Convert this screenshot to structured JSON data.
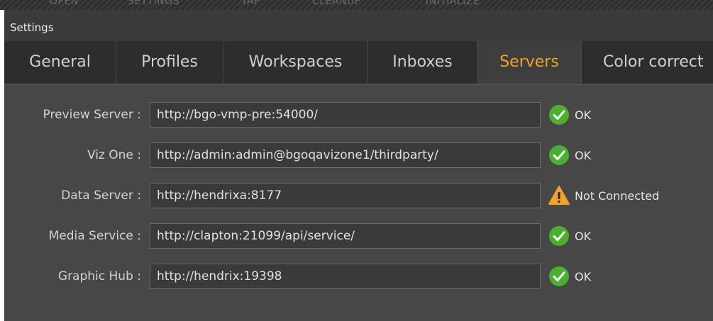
{
  "background_toolbar": {
    "labels": [
      "OPEN",
      "SETTINGS",
      "TAP",
      "CLEANUP",
      "INITIALIZE"
    ]
  },
  "dialog": {
    "title": "Settings"
  },
  "tabs": [
    {
      "label": "General",
      "active": false
    },
    {
      "label": "Profiles",
      "active": false
    },
    {
      "label": "Workspaces",
      "active": false
    },
    {
      "label": "Inboxes",
      "active": false
    },
    {
      "label": "Servers",
      "active": true
    },
    {
      "label": "Color correct",
      "active": false
    }
  ],
  "servers": [
    {
      "label": "Preview Server :",
      "value": "http://bgo-vmp-pre:54000/",
      "status": "OK",
      "status_icon": "check-circle-icon"
    },
    {
      "label": "Viz One :",
      "value": "http://admin:admin@bgoqavizone1/thirdparty/",
      "status": "OK",
      "status_icon": "check-circle-icon"
    },
    {
      "label": "Data Server :",
      "value": "http://hendrixa:8177",
      "status": "Not Connected",
      "status_icon": "warning-icon"
    },
    {
      "label": "Media Service :",
      "value": "http://clapton:21099/api/service/",
      "status": "OK",
      "status_icon": "check-circle-icon"
    },
    {
      "label": "Graphic Hub :",
      "value": "http://hendrix:19398",
      "status": "OK",
      "status_icon": "check-circle-icon"
    }
  ],
  "colors": {
    "active_tab": "#f0a22a",
    "ok_green": "#4caf32",
    "warning_orange": "#f0a22a"
  }
}
